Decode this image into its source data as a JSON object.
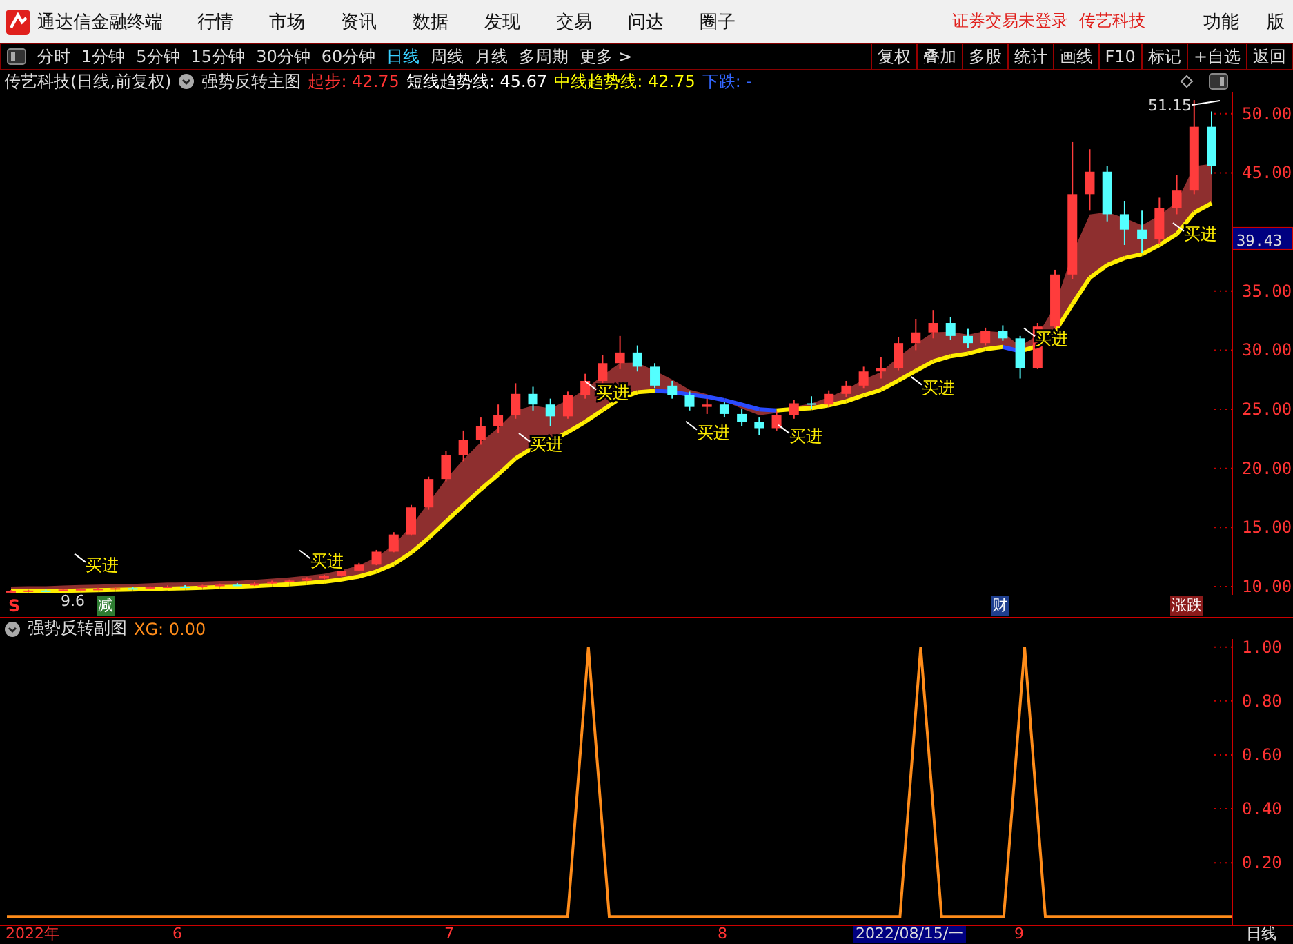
{
  "app": {
    "title": "通达信金融终端",
    "menus": [
      "行情",
      "市场",
      "资讯",
      "数据",
      "发现",
      "交易",
      "问达",
      "圈子"
    ],
    "login_status": "证券交易未登录",
    "stock_name": "传艺科技",
    "right_menus": [
      "功能",
      "版"
    ]
  },
  "periods": [
    {
      "label": "分时",
      "selected": false
    },
    {
      "label": "1分钟",
      "selected": false
    },
    {
      "label": "5分钟",
      "selected": false
    },
    {
      "label": "15分钟",
      "selected": false
    },
    {
      "label": "30分钟",
      "selected": false
    },
    {
      "label": "60分钟",
      "selected": false
    },
    {
      "label": "日线",
      "selected": true
    },
    {
      "label": "周线",
      "selected": false
    },
    {
      "label": "月线",
      "selected": false
    },
    {
      "label": "多周期",
      "selected": false
    },
    {
      "label": "更多 >",
      "selected": false
    }
  ],
  "tools": [
    "复权",
    "叠加",
    "多股",
    "统计",
    "画线",
    "F10",
    "标记",
    "+自选",
    "返回"
  ],
  "main_chart": {
    "title": "传艺科技(日线,前复权)",
    "indicator": "强势反转主图",
    "readouts": [
      {
        "label": "起步: 42.75",
        "color": "#ff3333"
      },
      {
        "label": "短线趋势线: 45.67",
        "color": "#ffffff"
      },
      {
        "label": "中线趋势线: 42.75",
        "color": "#ffff00"
      },
      {
        "label": "下跌: -",
        "color": "#3366ff"
      }
    ],
    "chart_data": {
      "type": "candlestick",
      "ylim": [
        9.3,
        51.8
      ],
      "yticks": [
        {
          "value": 50,
          "label": "50.00"
        },
        {
          "value": 45,
          "label": "45.00"
        },
        {
          "value": 35,
          "label": "35.00"
        },
        {
          "value": 30,
          "label": "30.00"
        },
        {
          "value": 25,
          "label": "25.00"
        },
        {
          "value": 20,
          "label": "20.00"
        },
        {
          "value": 15,
          "label": "15.00"
        },
        {
          "value": 10,
          "label": "10.00"
        }
      ],
      "ohlc": [
        [
          9.55,
          9.7,
          9.5,
          9.6
        ],
        [
          9.6,
          9.72,
          9.55,
          9.66
        ],
        [
          9.66,
          9.75,
          9.6,
          9.63
        ],
        [
          9.63,
          9.8,
          9.6,
          9.75
        ],
        [
          9.75,
          9.85,
          9.7,
          9.78
        ],
        [
          9.78,
          9.9,
          9.72,
          9.8
        ],
        [
          9.8,
          9.92,
          9.75,
          9.86
        ],
        [
          9.86,
          9.98,
          9.8,
          9.84
        ],
        [
          9.84,
          10.02,
          9.8,
          9.95
        ],
        [
          9.95,
          10.1,
          9.9,
          10.0
        ],
        [
          10.0,
          10.12,
          9.92,
          9.96
        ],
        [
          9.96,
          10.15,
          9.9,
          10.08
        ],
        [
          10.08,
          10.25,
          10.02,
          10.15
        ],
        [
          10.15,
          10.3,
          10.05,
          10.1
        ],
        [
          10.1,
          10.35,
          10.05,
          10.26
        ],
        [
          10.26,
          10.5,
          10.2,
          10.42
        ],
        [
          10.42,
          10.6,
          10.35,
          10.5
        ],
        [
          10.5,
          10.8,
          10.45,
          10.68
        ],
        [
          10.68,
          11.0,
          10.6,
          10.9
        ],
        [
          10.9,
          11.5,
          10.85,
          11.35
        ],
        [
          11.35,
          12.0,
          11.3,
          11.85
        ],
        [
          11.85,
          13.1,
          11.8,
          12.95
        ],
        [
          12.95,
          14.6,
          12.9,
          14.4
        ],
        [
          14.4,
          16.9,
          14.3,
          16.7
        ],
        [
          16.7,
          19.3,
          16.5,
          19.1
        ],
        [
          19.1,
          21.5,
          18.9,
          21.1
        ],
        [
          21.1,
          23.2,
          20.6,
          22.4
        ],
        [
          22.4,
          24.3,
          22.0,
          23.6
        ],
        [
          23.6,
          25.4,
          23.0,
          24.5
        ],
        [
          24.5,
          27.2,
          24.2,
          26.3
        ],
        [
          26.3,
          26.9,
          24.9,
          25.4
        ],
        [
          25.4,
          25.9,
          23.6,
          24.4
        ],
        [
          24.4,
          26.5,
          24.2,
          26.2
        ],
        [
          26.2,
          28.0,
          25.9,
          27.4
        ],
        [
          27.4,
          29.6,
          27.0,
          28.9
        ],
        [
          28.9,
          31.2,
          28.4,
          29.8
        ],
        [
          29.8,
          30.4,
          28.2,
          28.6
        ],
        [
          28.6,
          28.9,
          26.8,
          27.0
        ],
        [
          27.0,
          27.4,
          25.9,
          26.2
        ],
        [
          26.2,
          26.5,
          24.9,
          25.2
        ],
        [
          25.2,
          25.9,
          24.6,
          25.4
        ],
        [
          25.4,
          25.6,
          24.3,
          24.6
        ],
        [
          24.6,
          25.0,
          23.6,
          23.9
        ],
        [
          23.9,
          24.3,
          22.8,
          23.4
        ],
        [
          23.4,
          24.8,
          23.2,
          24.5
        ],
        [
          24.5,
          25.8,
          24.2,
          25.5
        ],
        [
          25.5,
          26.1,
          25.0,
          25.4
        ],
        [
          25.4,
          26.6,
          25.2,
          26.3
        ],
        [
          26.3,
          27.4,
          26.0,
          27.0
        ],
        [
          27.0,
          28.6,
          26.8,
          28.2
        ],
        [
          28.2,
          29.4,
          27.6,
          28.5
        ],
        [
          28.5,
          31.1,
          28.3,
          30.6
        ],
        [
          30.6,
          32.6,
          30.0,
          31.5
        ],
        [
          31.5,
          33.4,
          31.0,
          32.3
        ],
        [
          32.3,
          32.8,
          30.9,
          31.2
        ],
        [
          31.2,
          31.8,
          30.2,
          30.6
        ],
        [
          30.6,
          31.9,
          30.4,
          31.6
        ],
        [
          31.6,
          32.1,
          30.8,
          31.0
        ],
        [
          31.0,
          31.2,
          27.6,
          28.5
        ],
        [
          28.5,
          32.3,
          28.4,
          32.0
        ],
        [
          32.0,
          36.8,
          31.8,
          36.4
        ],
        [
          36.4,
          47.6,
          36.0,
          43.2
        ],
        [
          43.2,
          47.0,
          41.8,
          45.1
        ],
        [
          45.1,
          45.6,
          40.9,
          41.5
        ],
        [
          41.5,
          42.6,
          38.9,
          40.2
        ],
        [
          40.2,
          41.8,
          38.2,
          39.4
        ],
        [
          39.4,
          42.9,
          39.0,
          42.0
        ],
        [
          42.0,
          44.8,
          41.5,
          43.5
        ],
        [
          43.5,
          51.15,
          43.2,
          48.9
        ],
        [
          48.9,
          50.2,
          44.9,
          45.6
        ]
      ]
    },
    "current_price": "39.43",
    "high_label": "51.15",
    "low_label": "9.6",
    "signals": [
      "买进",
      "买进",
      "买进",
      "买进",
      "买进",
      "买进",
      "买进",
      "买进",
      "买进"
    ],
    "event_marks": [
      {
        "label": "S",
        "kind": "text",
        "color": "#ff3030"
      },
      {
        "label": "减",
        "kind": "badge",
        "color": "#2e7d32"
      },
      {
        "label": "财",
        "kind": "badge",
        "color": "#1f3f8f"
      },
      {
        "label": "涨跌",
        "kind": "badge",
        "color": "#8b1a1a"
      }
    ]
  },
  "sub_chart": {
    "title": "强势反转副图",
    "readout": ": 0.00",
    "chart_data": {
      "type": "line",
      "ylim": [
        -0.03,
        1.03
      ],
      "yticks": [
        {
          "value": 1,
          "label": "1.00"
        },
        {
          "value": 0.8,
          "label": "0.80"
        },
        {
          "value": 0.6,
          "label": "0.60"
        },
        {
          "value": 0.4,
          "label": "0.40"
        },
        {
          "value": 0.2,
          "label": "0.20"
        }
      ],
      "series": [
        {
          "name": "XG",
          "color": "#ff8c1a",
          "values": [
            0,
            0,
            0,
            0,
            0,
            0,
            0,
            0,
            0,
            0,
            0,
            0,
            0,
            0,
            0,
            0,
            0,
            0,
            0,
            0,
            0,
            0,
            0,
            0,
            0,
            0,
            0,
            0,
            1,
            0,
            0,
            0,
            0,
            0,
            0,
            0,
            0,
            0,
            0,
            0,
            0,
            0,
            0,
            0,
            1,
            0,
            0,
            0,
            0,
            1,
            0,
            0,
            0,
            0,
            0,
            0,
            0,
            0,
            0,
            0
          ]
        }
      ]
    }
  },
  "date_axis": {
    "labels": [
      "2022年",
      "6",
      "7",
      "8",
      "9"
    ],
    "cursor_date": "2022/08/15/一",
    "period": "日线"
  }
}
